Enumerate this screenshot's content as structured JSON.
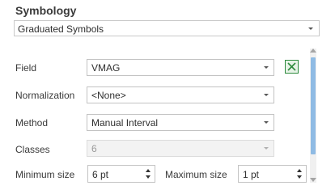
{
  "pane": {
    "title": "Symbology"
  },
  "renderer": {
    "value": "Graduated Symbols",
    "icon": "chevron-down-icon"
  },
  "field": {
    "label": "Field",
    "value": "VMAG",
    "icon": "chevron-down-icon",
    "calculate_icon": "excel-calculate-icon"
  },
  "normalization": {
    "label": "Normalization",
    "value": "<None>",
    "icon": "chevron-down-icon"
  },
  "method": {
    "label": "Method",
    "value": "Manual Interval",
    "icon": "chevron-down-icon"
  },
  "classes": {
    "label": "Classes",
    "value": "6",
    "enabled": false,
    "icon": "chevron-down-icon"
  },
  "size": {
    "min_label": "Minimum size",
    "min_value": "6 pt",
    "max_label": "Maximum size",
    "max_value": "1 pt"
  },
  "colors": {
    "accent": "#8fbbe4",
    "calculate_green": "#2e8b3e"
  }
}
